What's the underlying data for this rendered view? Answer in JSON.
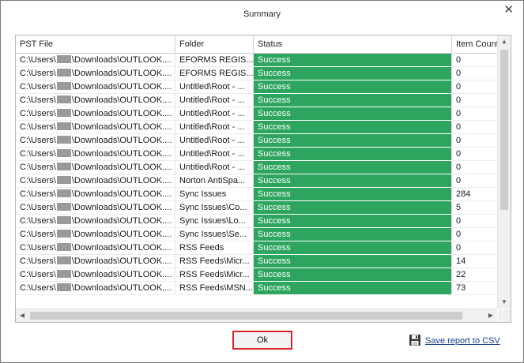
{
  "dialog": {
    "title": "Summary",
    "close_glyph": "✕",
    "ok_label": "Ok",
    "save_label": "Save report to CSV",
    "save_icon": "floppy-disk-icon"
  },
  "table": {
    "columns": [
      "PST File",
      "Folder",
      "Status",
      "Item Count"
    ],
    "rows": [
      {
        "file_prefix": "C:\\Users\\",
        "file_suffix": "\\Downloads\\OUTLOOK....",
        "folder": "EFORMS REGIS...",
        "status": "Success",
        "count": "0"
      },
      {
        "file_prefix": "C:\\Users\\",
        "file_suffix": "\\Downloads\\OUTLOOK....",
        "folder": "EFORMS REGIS...",
        "status": "Success",
        "count": "0"
      },
      {
        "file_prefix": "C:\\Users\\",
        "file_suffix": "\\Downloads\\OUTLOOK....",
        "folder": "Untitled\\Root - ...",
        "status": "Success",
        "count": "0"
      },
      {
        "file_prefix": "C:\\Users\\",
        "file_suffix": "\\Downloads\\OUTLOOK....",
        "folder": "Untitled\\Root - ...",
        "status": "Success",
        "count": "0"
      },
      {
        "file_prefix": "C:\\Users\\",
        "file_suffix": "\\Downloads\\OUTLOOK....",
        "folder": "Untitled\\Root - ...",
        "status": "Success",
        "count": "0"
      },
      {
        "file_prefix": "C:\\Users\\",
        "file_suffix": "\\Downloads\\OUTLOOK....",
        "folder": "Untitled\\Root - ...",
        "status": "Success",
        "count": "0"
      },
      {
        "file_prefix": "C:\\Users\\",
        "file_suffix": "\\Downloads\\OUTLOOK....",
        "folder": "Untitled\\Root - ...",
        "status": "Success",
        "count": "0"
      },
      {
        "file_prefix": "C:\\Users\\",
        "file_suffix": "\\Downloads\\OUTLOOK....",
        "folder": "Untitled\\Root - ...",
        "status": "Success",
        "count": "0"
      },
      {
        "file_prefix": "C:\\Users\\",
        "file_suffix": "\\Downloads\\OUTLOOK....",
        "folder": "Untitled\\Root - ...",
        "status": "Success",
        "count": "0"
      },
      {
        "file_prefix": "C:\\Users\\",
        "file_suffix": "\\Downloads\\OUTLOOK....",
        "folder": "Norton AntiSpa...",
        "status": "Success",
        "count": "0"
      },
      {
        "file_prefix": "C:\\Users\\",
        "file_suffix": "\\Downloads\\OUTLOOK....",
        "folder": "Sync Issues",
        "status": "Success",
        "count": "284"
      },
      {
        "file_prefix": "C:\\Users\\",
        "file_suffix": "\\Downloads\\OUTLOOK....",
        "folder": "Sync Issues\\Co...",
        "status": "Success",
        "count": "5"
      },
      {
        "file_prefix": "C:\\Users\\",
        "file_suffix": "\\Downloads\\OUTLOOK....",
        "folder": "Sync Issues\\Lo...",
        "status": "Success",
        "count": "0"
      },
      {
        "file_prefix": "C:\\Users\\",
        "file_suffix": "\\Downloads\\OUTLOOK....",
        "folder": "Sync Issues\\Se...",
        "status": "Success",
        "count": "0"
      },
      {
        "file_prefix": "C:\\Users\\",
        "file_suffix": "\\Downloads\\OUTLOOK....",
        "folder": "RSS Feeds",
        "status": "Success",
        "count": "0"
      },
      {
        "file_prefix": "C:\\Users\\",
        "file_suffix": "\\Downloads\\OUTLOOK....",
        "folder": "RSS Feeds\\Micr...",
        "status": "Success",
        "count": "14"
      },
      {
        "file_prefix": "C:\\Users\\",
        "file_suffix": "\\Downloads\\OUTLOOK....",
        "folder": "RSS Feeds\\Micr...",
        "status": "Success",
        "count": "22"
      },
      {
        "file_prefix": "C:\\Users\\",
        "file_suffix": "\\Downloads\\OUTLOOK....",
        "folder": "RSS Feeds\\MSN...",
        "status": "Success",
        "count": "73"
      }
    ]
  },
  "colors": {
    "success": "#2ea55e",
    "ok_highlight": "#d9262a",
    "link": "#1a3f8f"
  }
}
